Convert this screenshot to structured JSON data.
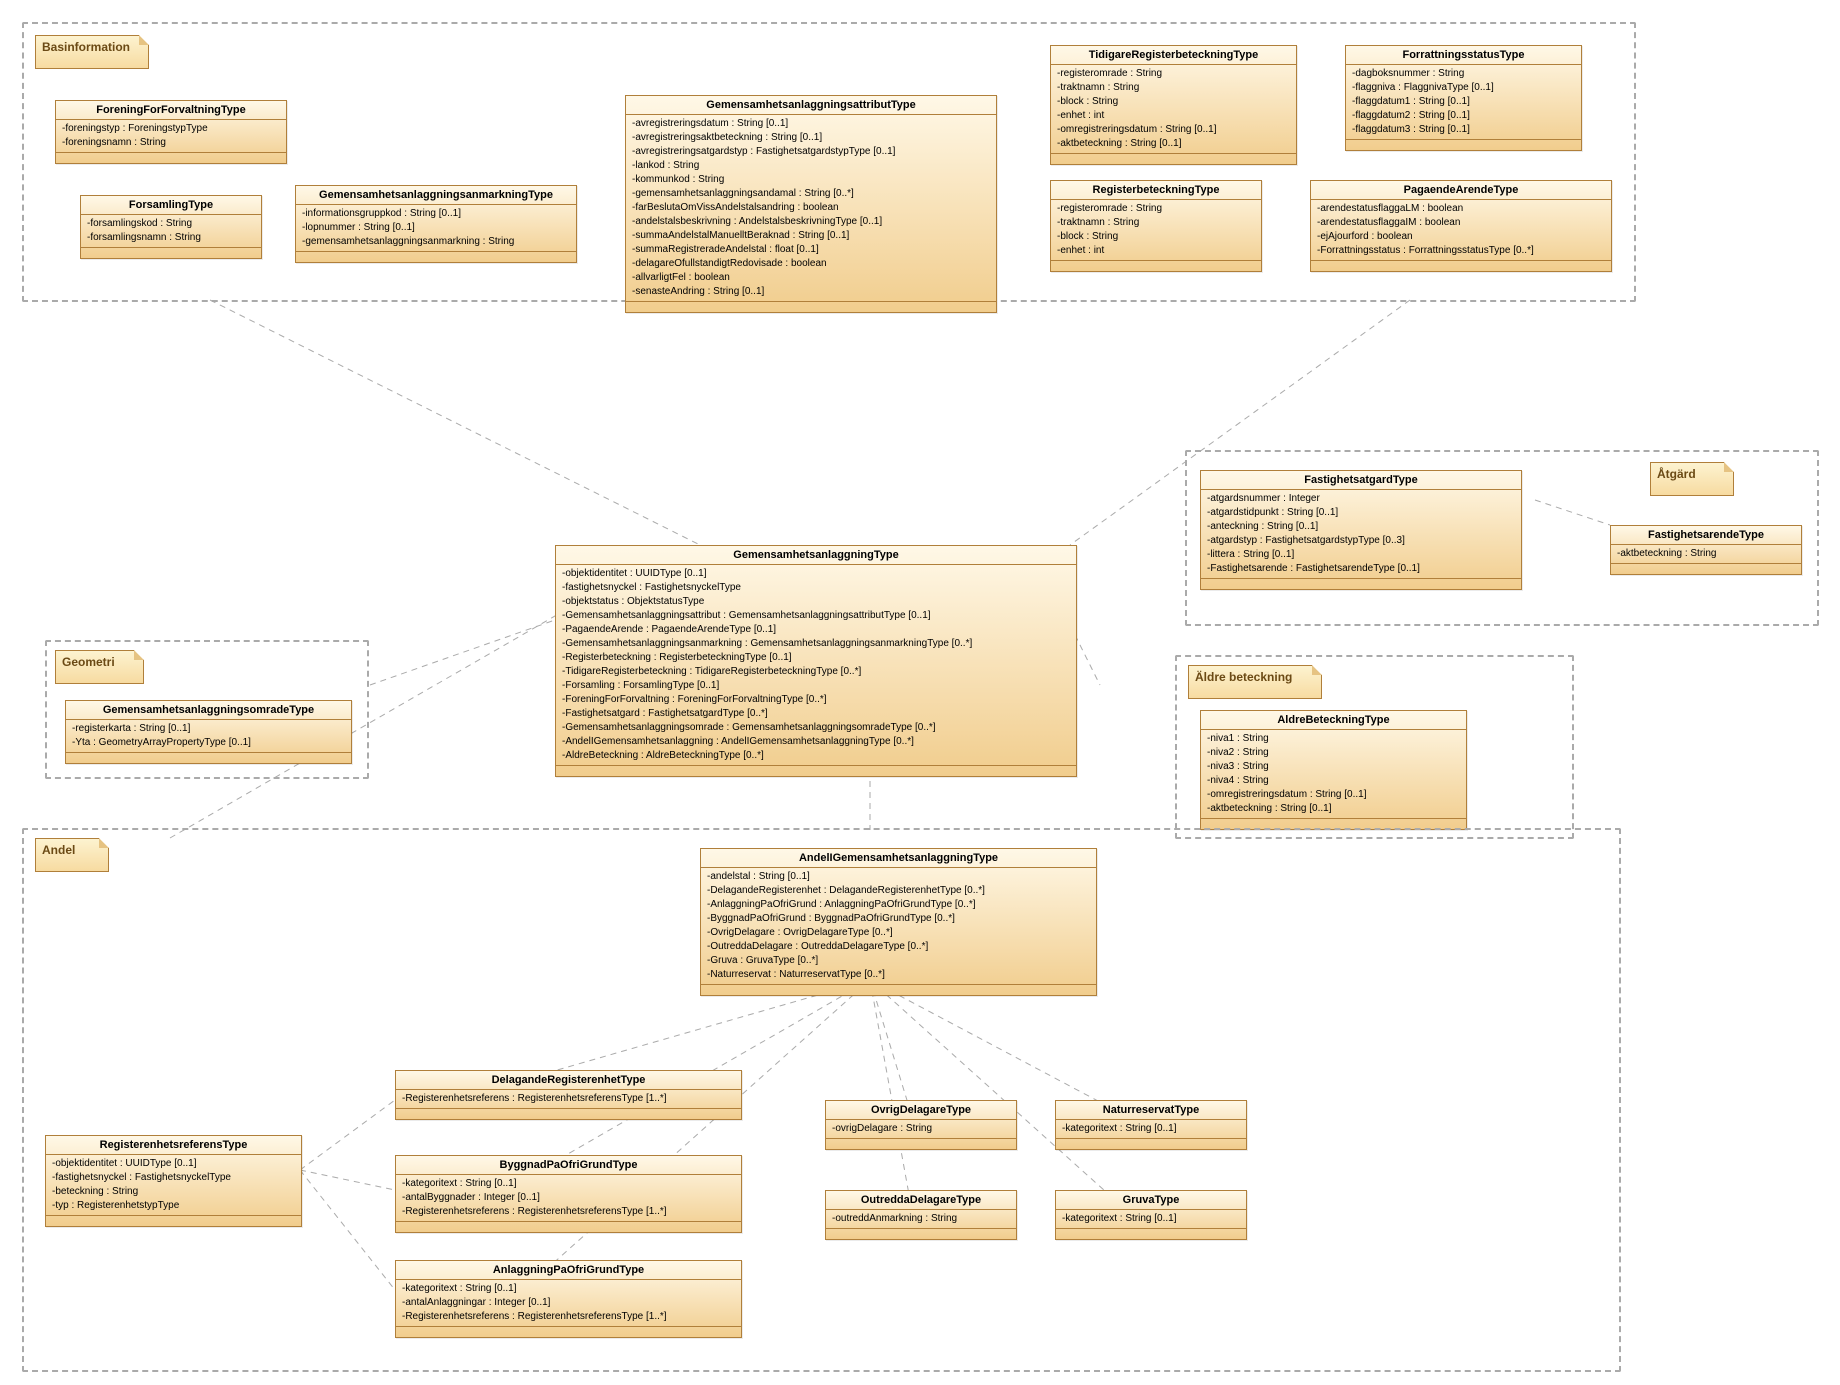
{
  "notes": {
    "basinformation": "Basinformation",
    "geometri": "Geometri",
    "andel": "Andel",
    "atgard": "Åtgärd",
    "aldre": "Äldre beteckning"
  },
  "classes": {
    "ForeningForForvaltningType": {
      "title": "ForeningForForvaltningType",
      "attrs": [
        "-foreningstyp : ForeningstypType",
        "-foreningsnamn : String"
      ]
    },
    "ForsamlingType": {
      "title": "ForsamlingType",
      "attrs": [
        "-forsamlingskod : String",
        "-forsamlingsnamn : String"
      ]
    },
    "GemensamhetsanlaggningsanmarkningType": {
      "title": "GemensamhetsanlaggningsanmarkningType",
      "attrs": [
        "-informationsgruppkod : String [0..1]",
        "-lopnummer : String [0..1]",
        "-gemensamhetsanlaggningsanmarkning : String"
      ]
    },
    "GemensamhetsanlaggningsattributType": {
      "title": "GemensamhetsanlaggningsattributType",
      "attrs": [
        "-avregistreringsdatum : String [0..1]",
        "-avregistreringsaktbeteckning : String [0..1]",
        "-avregistreringsatgardstyp : FastighetsatgardstypType [0..1]",
        "-lankod : String",
        "-kommunkod : String",
        "-gemensamhetsanlaggningsandamal : String [0..*]",
        "-farBeslutaOmVissAndelstalsandring : boolean",
        "-andelstalsbeskrivning : AndelstalsbeskrivningType [0..1]",
        "-summaAndelstalManuelltBeraknad : String [0..1]",
        "-summaRegistreradeAndelstal : float [0..1]",
        "-delagareOfullstandigtRedovisade : boolean",
        "-allvarligtFel : boolean",
        "-senasteAndring : String [0..1]"
      ]
    },
    "TidigareRegisterbeteckningType": {
      "title": "TidigareRegisterbeteckningType",
      "attrs": [
        "-registeromrade : String",
        "-traktnamn : String",
        "-block : String",
        "-enhet : int",
        "-omregistreringsdatum : String [0..1]",
        "-aktbeteckning : String [0..1]"
      ]
    },
    "ForrattningsstatusType": {
      "title": "ForrattningsstatusType",
      "attrs": [
        "-dagboksnummer : String",
        "-flaggniva : FlaggnivaType [0..1]",
        "-flaggdatum1 : String [0..1]",
        "-flaggdatum2 : String [0..1]",
        "-flaggdatum3 : String [0..1]"
      ]
    },
    "RegisterbeteckningType": {
      "title": "RegisterbeteckningType",
      "attrs": [
        "-registeromrade : String",
        "-traktnamn : String",
        "-block : String",
        "-enhet : int"
      ]
    },
    "PagaendeArendeType": {
      "title": "PagaendeArendeType",
      "attrs": [
        "-arendestatusflaggaLM : boolean",
        "-arendestatusflaggaIM : boolean",
        "-ejAjourford : boolean",
        "-Forrattningsstatus : ForrattningsstatusType [0..*]"
      ]
    },
    "GemensamhetsanlaggningsomradeType": {
      "title": "GemensamhetsanlaggningsomradeType",
      "attrs": [
        "-registerkarta : String [0..1]",
        "-Yta : GeometryArrayPropertyType [0..1]"
      ]
    },
    "GemensamhetsanlaggningType": {
      "title": "GemensamhetsanlaggningType",
      "attrs": [
        "-objektidentitet : UUIDType [0..1]",
        "-fastighetsnyckel : FastighetsnyckelType",
        "-objektstatus : ObjektstatusType",
        "-Gemensamhetsanlaggningsattribut : GemensamhetsanlaggningsattributType [0..1]",
        "-PagaendeArende : PagaendeArendeType [0..1]",
        "-Gemensamhetsanlaggningsanmarkning : GemensamhetsanlaggningsanmarkningType [0..*]",
        "-Registerbeteckning : RegisterbeteckningType [0..1]",
        "-TidigareRegisterbeteckning : TidigareRegisterbeteckningType [0..*]",
        "-Forsamling : ForsamlingType [0..1]",
        "-ForeningForForvaltning : ForeningForForvaltningType [0..*]",
        "-Fastighetsatgard : FastighetsatgardType [0..*]",
        "-Gemensamhetsanlaggningsomrade : GemensamhetsanlaggningsomradeType [0..*]",
        "-AndelIGemensamhetsanlaggning : AndelIGemensamhetsanlaggningType [0..*]",
        "-AldreBeteckning : AldreBeteckningType [0..*]"
      ]
    },
    "FastighetsatgardType": {
      "title": "FastighetsatgardType",
      "attrs": [
        "-atgardsnummer : Integer",
        "-atgardstidpunkt : String [0..1]",
        "-anteckning : String [0..1]",
        "-atgardstyp : FastighetsatgardstypType [0..3]",
        "-littera : String [0..1]",
        "-Fastighetsarende : FastighetsarendeType [0..1]"
      ]
    },
    "FastighetsarendeType": {
      "title": "FastighetsarendeType",
      "attrs": [
        "-aktbeteckning : String"
      ]
    },
    "AldreBeteckningType": {
      "title": "AldreBeteckningType",
      "attrs": [
        "-niva1 : String",
        "-niva2 : String",
        "-niva3 : String",
        "-niva4 : String",
        "-omregistreringsdatum : String [0..1]",
        "-aktbeteckning : String [0..1]"
      ]
    },
    "AndelIGemensamhetsanlaggningType": {
      "title": "AndelIGemensamhetsanlaggningType",
      "attrs": [
        "-andelstal : String [0..1]",
        "-DelagandeRegisterenhet : DelagandeRegisterenhetType [0..*]",
        "-AnlaggningPaOfriGrund : AnlaggningPaOfriGrundType [0..*]",
        "-ByggnadPaOfriGrund : ByggnadPaOfriGrundType [0..*]",
        "-OvrigDelagare : OvrigDelagareType [0..*]",
        "-OutreddaDelagare : OutreddaDelagareType [0..*]",
        "-Gruva : GruvaType [0..*]",
        "-Naturreservat : NaturreservatType [0..*]"
      ]
    },
    "RegisterenhetsreferensType": {
      "title": "RegisterenhetsreferensType",
      "attrs": [
        "-objektidentitet : UUIDType [0..1]",
        "-fastighetsnyckel : FastighetsnyckelType",
        "-beteckning : String",
        "-typ : RegisterenhetstypType"
      ]
    },
    "DelagandeRegisterenhetType": {
      "title": "DelagandeRegisterenhetType",
      "attrs": [
        "-Registerenhetsreferens : RegisterenhetsreferensType [1..*]"
      ]
    },
    "ByggnadPaOfriGrundType": {
      "title": "ByggnadPaOfriGrundType",
      "attrs": [
        "-kategoritext : String [0..1]",
        "-antalByggnader : Integer [0..1]",
        "-Registerenhetsreferens : RegisterenhetsreferensType [1..*]"
      ]
    },
    "AnlaggningPaOfriGrundType": {
      "title": "AnlaggningPaOfriGrundType",
      "attrs": [
        "-kategoritext : String [0..1]",
        "-antalAnlaggningar : Integer [0..1]",
        "-Registerenhetsreferens : RegisterenhetsreferensType [1..*]"
      ]
    },
    "OvrigDelagareType": {
      "title": "OvrigDelagareType",
      "attrs": [
        "-ovrigDelagare : String"
      ]
    },
    "OutreddaDelagareType": {
      "title": "OutreddaDelagareType",
      "attrs": [
        "-outreddAnmarkning : String"
      ]
    },
    "NaturreservatType": {
      "title": "NaturreservatType",
      "attrs": [
        "-kategoritext : String [0..1]"
      ]
    },
    "GruvaType": {
      "title": "GruvaType",
      "attrs": [
        "-kategoritext : String [0..1]"
      ]
    }
  }
}
